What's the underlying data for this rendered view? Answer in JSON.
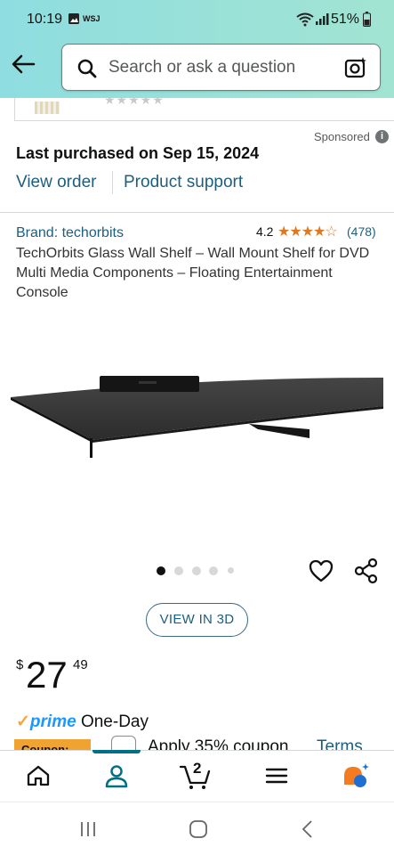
{
  "status_bar": {
    "time": "10:19",
    "carrier_badge": "WSJ",
    "battery": "51%"
  },
  "search": {
    "placeholder": "Search or ask a question"
  },
  "sponsored": {
    "label": "Sponsored",
    "info_glyph": "i"
  },
  "purchase": {
    "last_purchased": "Last purchased on Sep 15, 2024",
    "view_order": "View order",
    "product_support": "Product support"
  },
  "product": {
    "brand": "Brand: techorbits",
    "rating": "4.2",
    "stars": "★★★★☆",
    "rating_count": "(478)",
    "title": "TechOrbits Glass Wall Shelf – Wall Mount Shelf for DVD Multi Media Components – Floating Entertainment Console",
    "image_count": 5,
    "active_image_index": 0
  },
  "view_3d": {
    "label": "VIEW IN 3D"
  },
  "price": {
    "symbol": "$",
    "whole": "27",
    "fraction": "49"
  },
  "delivery": {
    "check": "✓",
    "prime": "prime",
    "speed": "One-Day"
  },
  "coupon": {
    "tag": "Coupon:",
    "text": "Apply 35% coupon",
    "terms": "Terms"
  },
  "bottom_nav": {
    "cart_count": "2",
    "active": "account"
  },
  "colors": {
    "header_gradient_start": "#8fdde0",
    "header_gradient_end": "#a2e4d2",
    "link": "#1d5e7e",
    "star": "#de7921",
    "prime_blue": "#1a98ff",
    "coupon_orange": "#f0a330",
    "nav_active": "#007185"
  },
  "icons": [
    "back-arrow-icon",
    "search-icon",
    "camera-sparkle-icon",
    "info-icon",
    "heart-icon",
    "share-icon",
    "home-icon",
    "account-icon",
    "cart-icon",
    "menu-icon",
    "rufus-ai-icon",
    "recents-icon",
    "home-circle-icon",
    "back-chevron-icon"
  ]
}
